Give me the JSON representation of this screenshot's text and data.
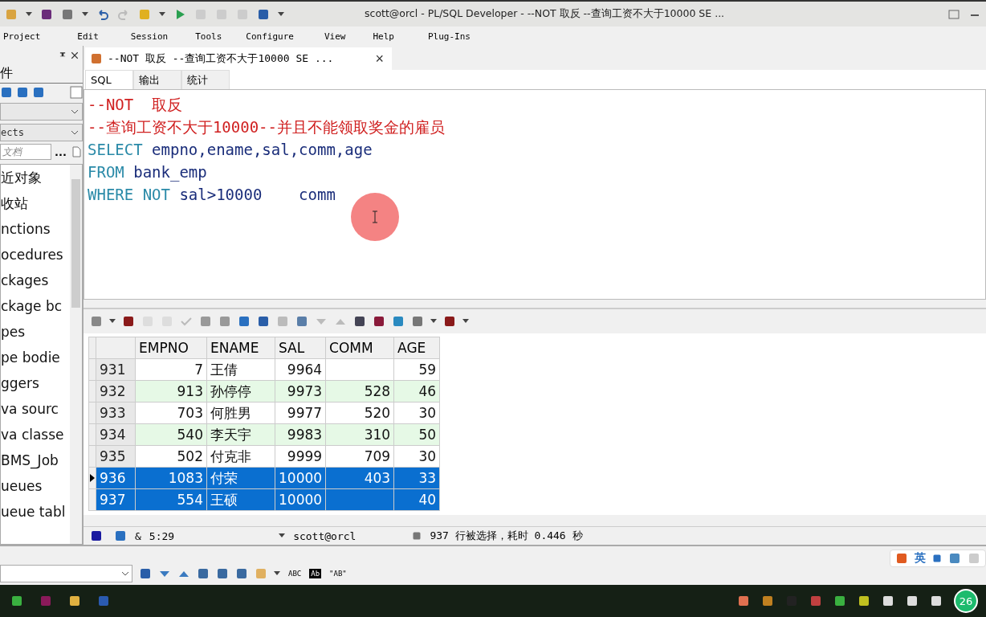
{
  "title_bar": {
    "title": "scott@orcl - PL/SQL Developer - --NOT 取反 --查询工资不大于10000 SE ..."
  },
  "menu": [
    "Project",
    "Edit",
    "Session",
    "Tools",
    "Configure",
    "View",
    "Help",
    "Plug-Ins"
  ],
  "left_panel": {
    "heading": "件",
    "filter": "ects",
    "search_placeholder": "文档",
    "more": "...",
    "items": [
      "近对象",
      "收站",
      "nctions",
      "ocedures",
      "ckages",
      "ckage bc",
      "pes",
      "pe bodie",
      "ggers",
      "va sourc",
      "va classe",
      "BMS_Job",
      "ueues",
      "ueue tabl"
    ]
  },
  "document_tab": {
    "title": "--NOT 取反 --查询工资不大于10000 SE ...",
    "close": "×"
  },
  "editor_tabs": [
    {
      "label": "SQL",
      "selected": true
    },
    {
      "label": "输出",
      "selected": false
    },
    {
      "label": "统计",
      "selected": false
    }
  ],
  "sql_lines": [
    {
      "kind": "comment",
      "text": "--NOT  取反"
    },
    {
      "kind": "comment",
      "text": "--查询工资不大于10000--并且不能领取奖金的雇员"
    },
    {
      "kind": "code",
      "tokens": [
        {
          "kind": "keyword",
          "text": "SELECT"
        },
        {
          "kind": "plain",
          "text": " empno,ename,sal,comm,age"
        }
      ]
    },
    {
      "kind": "code",
      "tokens": [
        {
          "kind": "keyword",
          "text": "FROM"
        },
        {
          "kind": "plain",
          "text": " bank_emp"
        }
      ]
    },
    {
      "kind": "code",
      "tokens": [
        {
          "kind": "keyword",
          "text": "WHERE NOT"
        },
        {
          "kind": "plain",
          "text": " sal>10000    comm"
        }
      ]
    }
  ],
  "grid": {
    "columns": [
      "EMPNO",
      "ENAME",
      "SAL",
      "COMM",
      "AGE"
    ],
    "rows": [
      {
        "number": "931",
        "cells": [
          "7",
          "王倩",
          "9964",
          "",
          "59"
        ],
        "selected": false,
        "current": false
      },
      {
        "number": "932",
        "cells": [
          "913",
          "孙停停",
          "9973",
          "528",
          "46"
        ],
        "selected": false,
        "current": false
      },
      {
        "number": "933",
        "cells": [
          "703",
          "何胜男",
          "9977",
          "520",
          "30"
        ],
        "selected": false,
        "current": false
      },
      {
        "number": "934",
        "cells": [
          "540",
          "李天宇",
          "9983",
          "310",
          "50"
        ],
        "selected": false,
        "current": false
      },
      {
        "number": "935",
        "cells": [
          "502",
          "付克非",
          "9999",
          "709",
          "30"
        ],
        "selected": false,
        "current": false
      },
      {
        "number": "936",
        "cells": [
          "1083",
          "付荣",
          "10000",
          "403",
          "33"
        ],
        "selected": true,
        "current": true
      },
      {
        "number": "937",
        "cells": [
          "554",
          "王硕",
          "10000",
          "",
          "40"
        ],
        "selected": true,
        "current": false
      }
    ]
  },
  "status_bar": {
    "mode": "&",
    "position": "5:29",
    "connection": "scott@orcl",
    "message": "937 行被选择，耗时 0.446 秒"
  },
  "find_bar": {
    "options": [
      {
        "label": "ABC",
        "selected": false
      },
      {
        "label": "Ab",
        "selected": true
      },
      {
        "label": "\"AB\"",
        "selected": false
      }
    ]
  },
  "ime": {
    "language": "英"
  },
  "taskbar": {
    "badge": "26"
  }
}
